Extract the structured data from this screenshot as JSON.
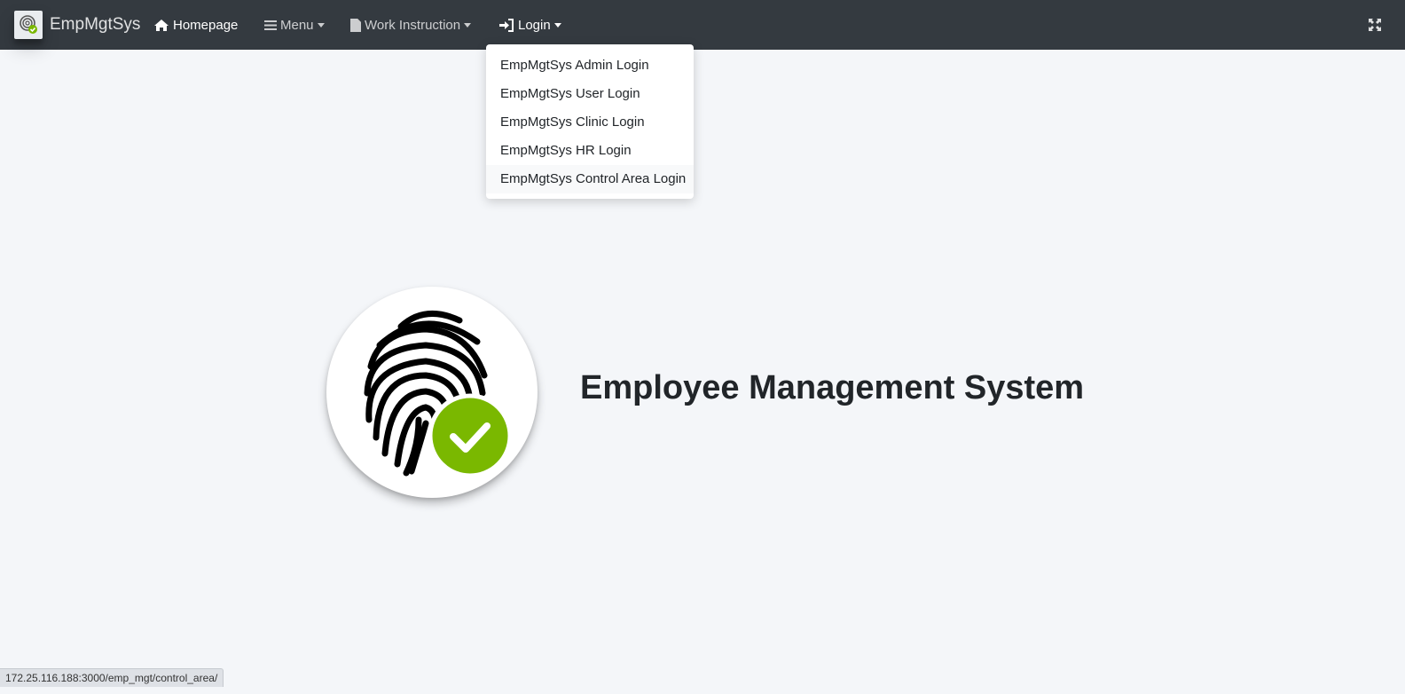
{
  "navbar": {
    "brand": "EmpMgtSys",
    "items": [
      {
        "label": "Homepage",
        "icon": "home-icon"
      },
      {
        "label": "Menu",
        "icon": "bars-icon"
      },
      {
        "label": "Work Instruction",
        "icon": "file-icon"
      },
      {
        "label": "Login",
        "icon": "sign-in-icon"
      }
    ],
    "expand_icon": "expand-icon"
  },
  "login_dropdown": {
    "items": [
      "EmpMgtSys Admin Login",
      "EmpMgtSys User Login",
      "EmpMgtSys Clinic Login",
      "EmpMgtSys HR Login",
      "EmpMgtSys Control Area Login"
    ]
  },
  "hero": {
    "title": "Employee Management System",
    "logo_icon": "fingerprint-check-icon"
  },
  "status_bar": {
    "url": "172.25.116.188:3000/emp_mgt/control_area/"
  },
  "colors": {
    "navbar": "#343a40",
    "background": "#f4f6f9",
    "check_green": "#7ab800"
  }
}
